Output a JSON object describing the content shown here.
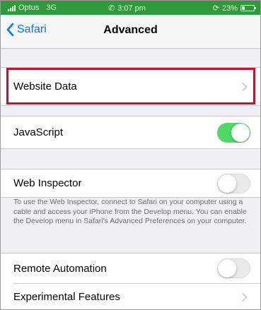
{
  "status_bar": {
    "carrier": "Optus",
    "network": "3G",
    "time": "3:07 pm",
    "battery_text": "23%",
    "battery_level": 0.23
  },
  "nav": {
    "back_label": "Safari",
    "title": "Advanced"
  },
  "settings": {
    "website_data": "Website Data",
    "javascript": {
      "label": "JavaScript",
      "enabled": true
    },
    "web_inspector": {
      "label": "Web Inspector",
      "enabled": false,
      "note": "To use the Web Inspector, connect to Safari on your computer using a cable and access your iPhone from the Develop menu. You can enable the Develop menu in Safari's Advanced Preferences on your computer."
    },
    "remote_automation": {
      "label": "Remote Automation",
      "enabled": false
    },
    "experimental_features": "Experimental Features"
  },
  "colors": {
    "accent": "#007aff",
    "toggle_on": "#4cd964",
    "status_bar": "#2f9a3a",
    "highlight": "#c8102e"
  }
}
